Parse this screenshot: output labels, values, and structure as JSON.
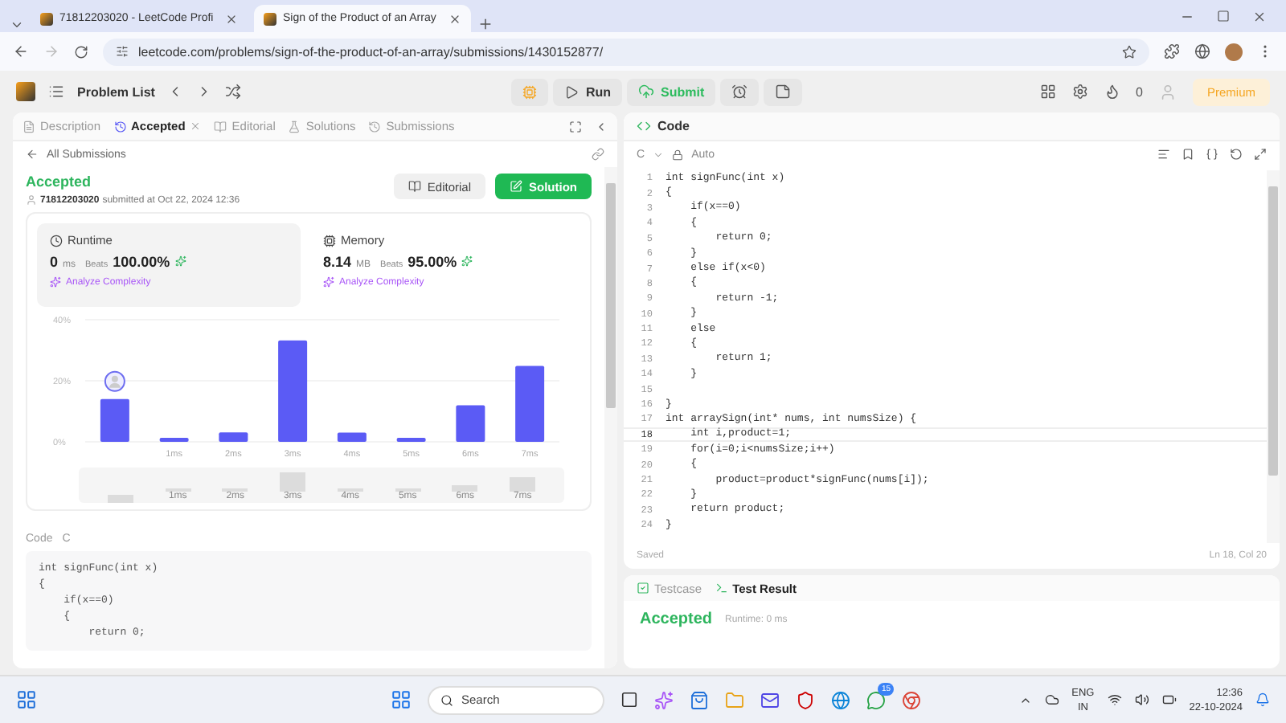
{
  "browser": {
    "tabs": [
      {
        "title": "71812203020 - LeetCode Profi",
        "selected": false
      },
      {
        "title": "Sign of the Product of an Array",
        "selected": true
      }
    ],
    "url": "leetcode.com/problems/sign-of-the-product-of-an-array/submissions/1430152877/"
  },
  "nav": {
    "problem_list": "Problem List",
    "run": "Run",
    "submit": "Submit",
    "streak": "0",
    "premium": "Premium"
  },
  "left_tabs": [
    {
      "label": "Description",
      "selected": false
    },
    {
      "label": "Accepted",
      "selected": true
    },
    {
      "label": "Editorial",
      "selected": false
    },
    {
      "label": "Solutions",
      "selected": false
    },
    {
      "label": "Submissions",
      "selected": false
    }
  ],
  "back_link": "All Submissions",
  "submission": {
    "status": "Accepted",
    "user": "71812203020",
    "submitted": "submitted at Oct 22, 2024 12:36",
    "editorial_button": "Editorial",
    "solution_button": "Solution"
  },
  "stats": [
    {
      "kind": "runtime",
      "title": "Runtime",
      "value": "0",
      "unit": "ms",
      "beats_label": "Beats",
      "beats": "100.00%",
      "analyze": "Analyze Complexity",
      "selected": true
    },
    {
      "kind": "memory",
      "title": "Memory",
      "value": "8.14",
      "unit": "MB",
      "beats_label": "Beats",
      "beats": "95.00%",
      "analyze": "Analyze Complexity",
      "selected": false
    }
  ],
  "chart_data": {
    "type": "bar",
    "categories": [
      null,
      "1ms",
      "2ms",
      "3ms",
      "4ms",
      "5ms",
      "6ms",
      "7ms"
    ],
    "series": [
      {
        "color": "#5b5bf5",
        "values": [
          14,
          1.3,
          3.1,
          33.2,
          3,
          1.3,
          12,
          24.9
        ]
      }
    ],
    "ylim": [
      0,
      40
    ],
    "yticks": [
      {
        "value": 0,
        "label": "0%"
      },
      {
        "value": 20,
        "label": "20%"
      },
      {
        "value": 40,
        "label": "40%"
      }
    ]
  },
  "brush_labels": [
    "1ms",
    "2ms",
    "3ms",
    "4ms",
    "5ms",
    "6ms",
    "7ms"
  ],
  "code_section": {
    "label": "Code",
    "language": "C",
    "lines": [
      "int signFunc(int x)",
      "{",
      "    if(x==0)",
      "    {",
      "        return 0;"
    ]
  },
  "editor": {
    "title": "Code",
    "language": "C",
    "mode": "Auto",
    "saved": "Saved",
    "cursor": "Ln 18, Col 20",
    "lines": [
      {
        "num": "1",
        "text": "int signFunc(int x)",
        "current": false
      },
      {
        "num": "2",
        "text": "{",
        "current": false
      },
      {
        "num": "3",
        "text": "    if(x==0)",
        "current": false
      },
      {
        "num": "4",
        "text": "    {",
        "current": false
      },
      {
        "num": "5",
        "text": "        return 0;",
        "current": false
      },
      {
        "num": "6",
        "text": "    }",
        "current": false
      },
      {
        "num": "7",
        "text": "    else if(x<0)",
        "current": false
      },
      {
        "num": "8",
        "text": "    {",
        "current": false
      },
      {
        "num": "9",
        "text": "        return -1;",
        "current": false
      },
      {
        "num": "10",
        "text": "    }",
        "current": false
      },
      {
        "num": "11",
        "text": "    else",
        "current": false
      },
      {
        "num": "12",
        "text": "    {",
        "current": false
      },
      {
        "num": "13",
        "text": "        return 1;",
        "current": false
      },
      {
        "num": "14",
        "text": "    }",
        "current": false
      },
      {
        "num": "15",
        "current": false
      },
      {
        "num": "16",
        "text": "}",
        "current": false
      },
      {
        "num": "17",
        "text": "int arraySign(int* nums, int numsSize) {",
        "current": false
      },
      {
        "num": "18",
        "text": "    int i,product=1;",
        "current": true
      },
      {
        "num": "19",
        "text": "    for(i=0;i<numsSize;i++)",
        "current": false
      },
      {
        "num": "20",
        "text": "    {",
        "current": false
      },
      {
        "num": "21",
        "text": "        product=product*signFunc(nums[i]);",
        "current": false
      },
      {
        "num": "22",
        "text": "    }",
        "current": false
      },
      {
        "num": "23",
        "text": "    return product;",
        "current": false
      },
      {
        "num": "24",
        "text": "}",
        "current": false
      }
    ]
  },
  "test_result": {
    "tabs": [
      {
        "label": "Testcase",
        "selected": false
      },
      {
        "label": "Test Result",
        "selected": true
      }
    ],
    "status": "Accepted",
    "runtime": "Runtime: 0 ms"
  },
  "taskbar": {
    "search": "Search",
    "badge": "15",
    "language": "ENG",
    "region": "IN",
    "time": "12:36",
    "date": "22-10-2024"
  }
}
